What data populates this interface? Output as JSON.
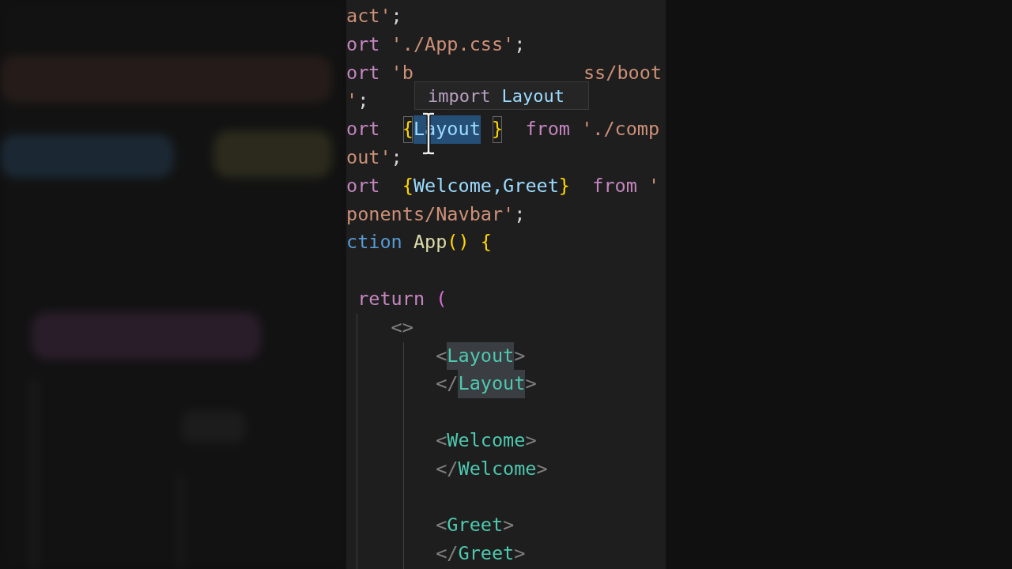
{
  "editor": {
    "lines": [
      {
        "kind": "code",
        "segments": [
          {
            "text": "act'",
            "kind": "string"
          },
          {
            "text": ";",
            "kind": "punct"
          }
        ]
      },
      {
        "kind": "code",
        "segments": [
          {
            "text": "ort",
            "kind": "keyword"
          },
          {
            "text": " './App.css'",
            "kind": "string"
          },
          {
            "text": ";",
            "kind": "punct"
          }
        ]
      },
      {
        "kind": "code",
        "segments": [
          {
            "text": "ort",
            "kind": "keyword"
          },
          {
            "text": " 'b",
            "kind": "string"
          },
          {
            "text": "ss/boot",
            "kind": "string-tail"
          }
        ]
      },
      {
        "kind": "code",
        "segments": [
          {
            "text": "'",
            "kind": "string"
          },
          {
            "text": ";",
            "kind": "punct"
          }
        ]
      },
      {
        "kind": "code",
        "segments": [
          {
            "text": "ort  ",
            "kind": "keyword"
          },
          {
            "text": "{",
            "kind": "matched-brace"
          },
          {
            "text": "Layout",
            "kind": "selected-identifier"
          },
          {
            "text": "}",
            "kind": "matched-brace-spaced"
          },
          {
            "text": "  from",
            "kind": "keyword"
          },
          {
            "text": " './comp",
            "kind": "string"
          }
        ]
      },
      {
        "kind": "code",
        "segments": [
          {
            "text": "out'",
            "kind": "string"
          },
          {
            "text": ";",
            "kind": "punct"
          }
        ]
      },
      {
        "kind": "code",
        "segments": [
          {
            "text": "ort  ",
            "kind": "keyword"
          },
          {
            "text": "{",
            "kind": "brace"
          },
          {
            "text": "Welcome,Greet",
            "kind": "identifier"
          },
          {
            "text": "}",
            "kind": "brace"
          },
          {
            "text": "  from",
            "kind": "keyword"
          },
          {
            "text": " '",
            "kind": "string"
          }
        ]
      },
      {
        "kind": "code",
        "segments": [
          {
            "text": "ponents/Navbar'",
            "kind": "string"
          },
          {
            "text": ";",
            "kind": "punct"
          }
        ]
      },
      {
        "kind": "code",
        "segments": [
          {
            "text": "ction",
            "kind": "storage"
          },
          {
            "text": " App",
            "kind": "function"
          },
          {
            "text": "() {",
            "kind": "brace"
          }
        ]
      },
      {
        "kind": "blank"
      },
      {
        "kind": "code",
        "segments": [
          {
            "text": " return",
            "kind": "keyword"
          },
          {
            "text": " (",
            "kind": "paren"
          }
        ]
      },
      {
        "kind": "code",
        "segments": [
          {
            "text": "    <>",
            "kind": "angle"
          }
        ]
      },
      {
        "kind": "code",
        "segments": [
          {
            "text": "        <",
            "kind": "angle"
          },
          {
            "text": "Layout",
            "kind": "matched-tag"
          },
          {
            "text": ">",
            "kind": "angle"
          }
        ]
      },
      {
        "kind": "code",
        "segments": [
          {
            "text": "        </",
            "kind": "angle"
          },
          {
            "text": "Layout",
            "kind": "matched-tag"
          },
          {
            "text": ">",
            "kind": "angle"
          }
        ]
      },
      {
        "kind": "blank"
      },
      {
        "kind": "code",
        "segments": [
          {
            "text": "        <",
            "kind": "angle"
          },
          {
            "text": "Welcome",
            "kind": "tag"
          },
          {
            "text": ">",
            "kind": "angle"
          }
        ]
      },
      {
        "kind": "code",
        "segments": [
          {
            "text": "        </",
            "kind": "angle"
          },
          {
            "text": "Welcome",
            "kind": "tag"
          },
          {
            "text": ">",
            "kind": "angle"
          }
        ]
      },
      {
        "kind": "blank"
      },
      {
        "kind": "code",
        "segments": [
          {
            "text": "        <",
            "kind": "angle"
          },
          {
            "text": "Greet",
            "kind": "tag"
          },
          {
            "text": ">",
            "kind": "angle"
          }
        ]
      },
      {
        "kind": "code",
        "segments": [
          {
            "text": "        </",
            "kind": "angle"
          },
          {
            "text": "Greet",
            "kind": "tag"
          },
          {
            "text": ">",
            "kind": "angle"
          }
        ]
      }
    ]
  },
  "hover_tooltip": {
    "keyword": "import",
    "name": "Layout"
  }
}
